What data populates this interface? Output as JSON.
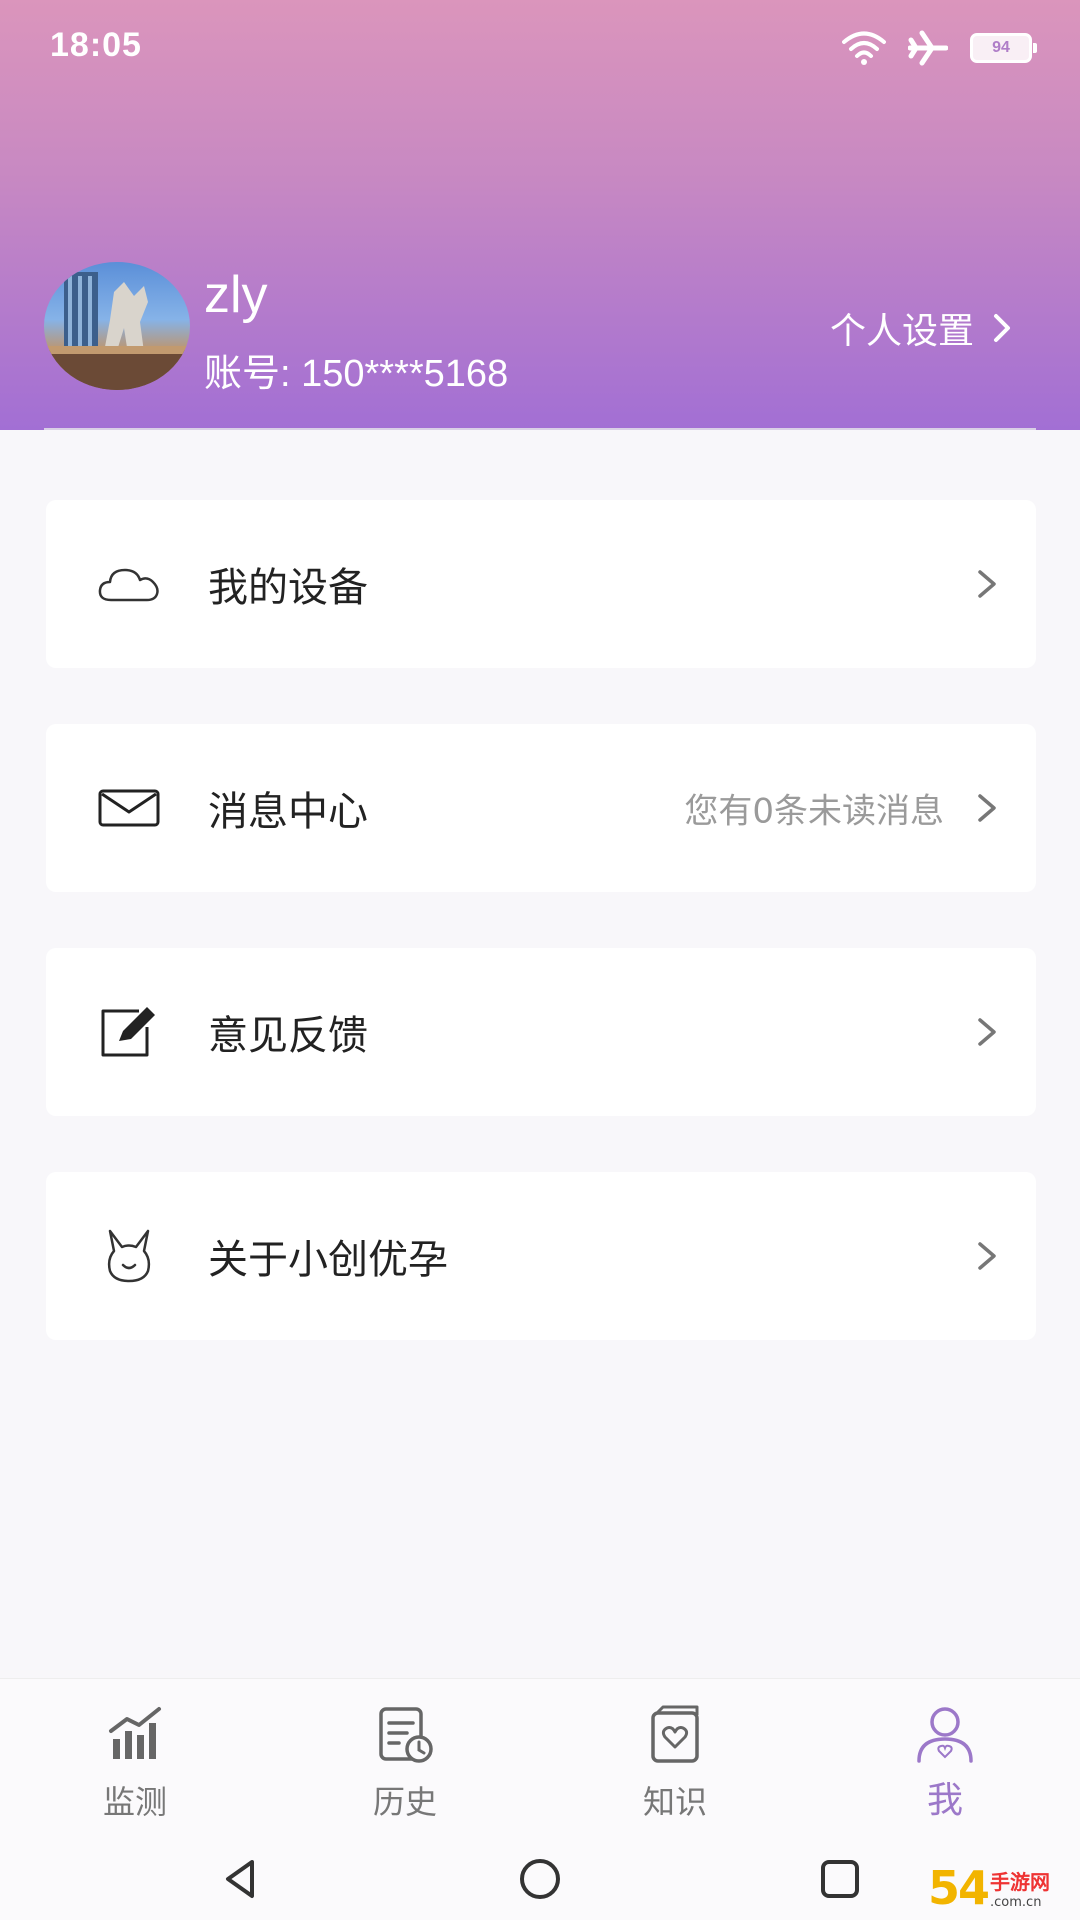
{
  "status_bar": {
    "time": "18:05",
    "battery": "94",
    "icons": [
      "wifi-icon",
      "airplane-icon",
      "battery-icon"
    ]
  },
  "profile": {
    "name": "zly",
    "account": "账号: 150****5168",
    "settings_label": "个人设置"
  },
  "menu": [
    {
      "id": "devices",
      "label": "我的设备",
      "icon": "cloud-icon",
      "hint": ""
    },
    {
      "id": "messages",
      "label": "消息中心",
      "icon": "mail-icon",
      "hint": "您有0条未读消息"
    },
    {
      "id": "feedback",
      "label": "意见反馈",
      "icon": "edit-icon",
      "hint": ""
    },
    {
      "id": "about",
      "label": "关于小创优孕",
      "icon": "bunny-icon",
      "hint": ""
    }
  ],
  "bottom_nav": [
    {
      "label": "监测",
      "icon": "chart-icon",
      "active": false
    },
    {
      "label": "历史",
      "icon": "history-icon",
      "active": false
    },
    {
      "label": "知识",
      "icon": "book-icon",
      "active": false
    },
    {
      "label": "我",
      "icon": "user-icon",
      "active": true
    }
  ],
  "colors": {
    "accent": "#9c78c9",
    "header_top": "#db95bc",
    "header_bottom": "#a26fd4"
  },
  "watermark": {
    "main": "54",
    "site": "手游网",
    "domain": ".com.cn"
  }
}
